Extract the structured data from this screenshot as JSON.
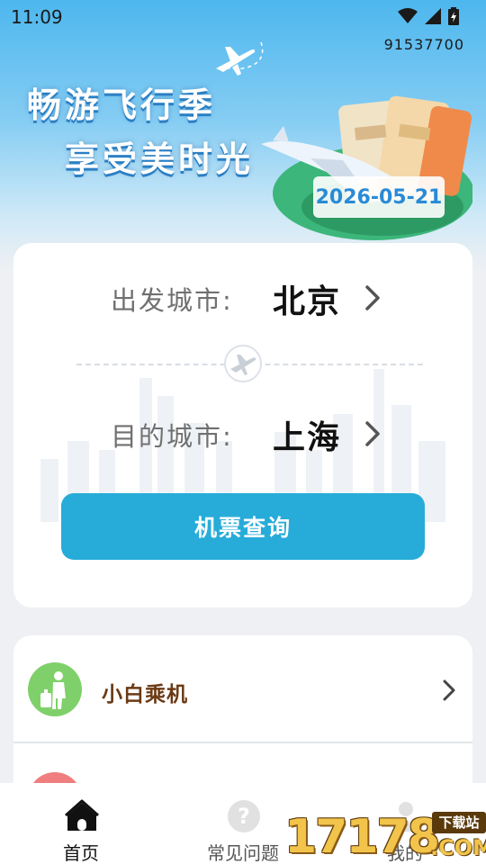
{
  "status_bar": {
    "time": "11:09",
    "number": "91537700"
  },
  "banner": {
    "slogan_line1": "畅游飞行季",
    "slogan_line2": "享受美时光",
    "date": "2026-05-21"
  },
  "search": {
    "depart_label": "出发城市:",
    "depart_city": "北京",
    "arrive_label": "目的城市:",
    "arrive_city": "上海",
    "button_label": "机票查询"
  },
  "menu": {
    "items": [
      {
        "label": "小白乘机",
        "icon": "traveler-luggage-icon"
      },
      {
        "label": "",
        "icon": "red-service-icon"
      }
    ]
  },
  "bottom_nav": {
    "items": [
      {
        "label": "首页",
        "icon": "home-icon",
        "active": true
      },
      {
        "label": "常见问题",
        "icon": "question-icon",
        "active": false
      },
      {
        "label": "我的",
        "icon": "profile-icon",
        "active": false
      }
    ]
  },
  "watermark": {
    "digits": "17178",
    "site": "下载站",
    "suffix": ".COM"
  },
  "colors": {
    "accent": "#27acd9",
    "sky": "#4db7ee",
    "menu_text": "#6b3a14"
  }
}
